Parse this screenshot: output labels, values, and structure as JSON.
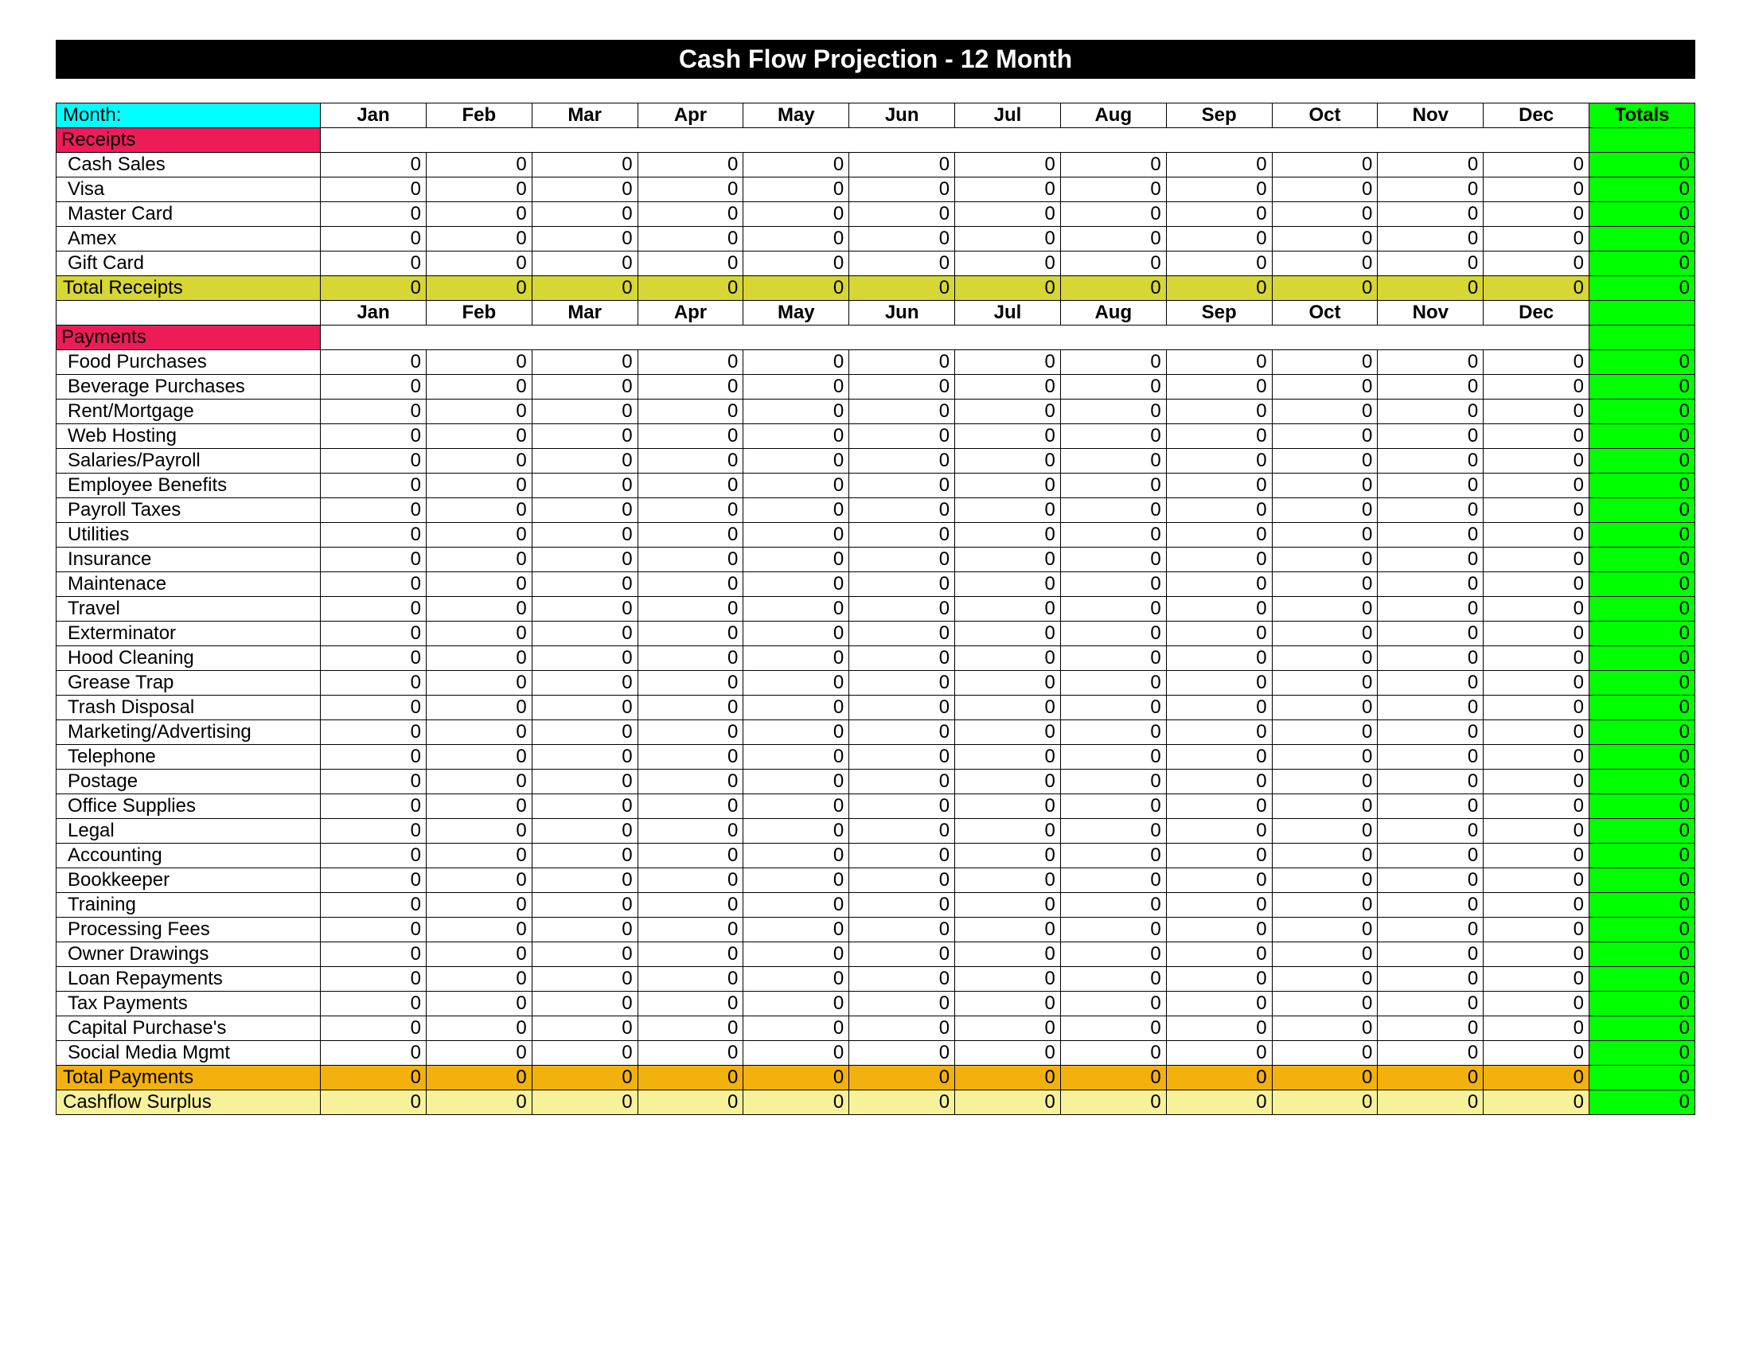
{
  "title": "Cash Flow Projection   -    12 Month",
  "month_label": "Month:",
  "months": [
    "Jan",
    "Feb",
    "Mar",
    "Apr",
    "May",
    "Jun",
    "Jul",
    "Aug",
    "Sep",
    "Oct",
    "Nov",
    "Dec"
  ],
  "totals_header": "Totals",
  "sections": {
    "receipts": {
      "label": "Receipts",
      "rows": [
        {
          "label": "Cash Sales",
          "v": [
            0,
            0,
            0,
            0,
            0,
            0,
            0,
            0,
            0,
            0,
            0,
            0
          ],
          "t": 0
        },
        {
          "label": "Visa",
          "v": [
            0,
            0,
            0,
            0,
            0,
            0,
            0,
            0,
            0,
            0,
            0,
            0
          ],
          "t": 0
        },
        {
          "label": "Master Card",
          "v": [
            0,
            0,
            0,
            0,
            0,
            0,
            0,
            0,
            0,
            0,
            0,
            0
          ],
          "t": 0
        },
        {
          "label": "Amex",
          "v": [
            0,
            0,
            0,
            0,
            0,
            0,
            0,
            0,
            0,
            0,
            0,
            0
          ],
          "t": 0
        },
        {
          "label": "Gift Card",
          "v": [
            0,
            0,
            0,
            0,
            0,
            0,
            0,
            0,
            0,
            0,
            0,
            0
          ],
          "t": 0
        }
      ],
      "total_label": "Total Receipts",
      "total_v": [
        0,
        0,
        0,
        0,
        0,
        0,
        0,
        0,
        0,
        0,
        0,
        0
      ],
      "total_t": 0
    },
    "payments": {
      "label": "Payments",
      "rows": [
        {
          "label": "Food Purchases",
          "v": [
            0,
            0,
            0,
            0,
            0,
            0,
            0,
            0,
            0,
            0,
            0,
            0
          ],
          "t": 0
        },
        {
          "label": "Beverage Purchases",
          "v": [
            0,
            0,
            0,
            0,
            0,
            0,
            0,
            0,
            0,
            0,
            0,
            0
          ],
          "t": 0
        },
        {
          "label": "Rent/Mortgage",
          "v": [
            0,
            0,
            0,
            0,
            0,
            0,
            0,
            0,
            0,
            0,
            0,
            0
          ],
          "t": 0
        },
        {
          "label": "Web Hosting",
          "v": [
            0,
            0,
            0,
            0,
            0,
            0,
            0,
            0,
            0,
            0,
            0,
            0
          ],
          "t": 0
        },
        {
          "label": "Salaries/Payroll",
          "v": [
            0,
            0,
            0,
            0,
            0,
            0,
            0,
            0,
            0,
            0,
            0,
            0
          ],
          "t": 0
        },
        {
          "label": "Employee Benefits",
          "v": [
            0,
            0,
            0,
            0,
            0,
            0,
            0,
            0,
            0,
            0,
            0,
            0
          ],
          "t": 0
        },
        {
          "label": "Payroll Taxes",
          "v": [
            0,
            0,
            0,
            0,
            0,
            0,
            0,
            0,
            0,
            0,
            0,
            0
          ],
          "t": 0
        },
        {
          "label": "Utilities",
          "v": [
            0,
            0,
            0,
            0,
            0,
            0,
            0,
            0,
            0,
            0,
            0,
            0
          ],
          "t": 0
        },
        {
          "label": "Insurance",
          "v": [
            0,
            0,
            0,
            0,
            0,
            0,
            0,
            0,
            0,
            0,
            0,
            0
          ],
          "t": 0
        },
        {
          "label": "Maintenace",
          "v": [
            0,
            0,
            0,
            0,
            0,
            0,
            0,
            0,
            0,
            0,
            0,
            0
          ],
          "t": 0
        },
        {
          "label": "Travel",
          "v": [
            0,
            0,
            0,
            0,
            0,
            0,
            0,
            0,
            0,
            0,
            0,
            0
          ],
          "t": 0
        },
        {
          "label": "Exterminator",
          "v": [
            0,
            0,
            0,
            0,
            0,
            0,
            0,
            0,
            0,
            0,
            0,
            0
          ],
          "t": 0
        },
        {
          "label": "Hood Cleaning",
          "v": [
            0,
            0,
            0,
            0,
            0,
            0,
            0,
            0,
            0,
            0,
            0,
            0
          ],
          "t": 0
        },
        {
          "label": "Grease Trap",
          "v": [
            0,
            0,
            0,
            0,
            0,
            0,
            0,
            0,
            0,
            0,
            0,
            0
          ],
          "t": 0
        },
        {
          "label": "Trash Disposal",
          "v": [
            0,
            0,
            0,
            0,
            0,
            0,
            0,
            0,
            0,
            0,
            0,
            0
          ],
          "t": 0
        },
        {
          "label": "Marketing/Advertising",
          "v": [
            0,
            0,
            0,
            0,
            0,
            0,
            0,
            0,
            0,
            0,
            0,
            0
          ],
          "t": 0
        },
        {
          "label": "Telephone",
          "v": [
            0,
            0,
            0,
            0,
            0,
            0,
            0,
            0,
            0,
            0,
            0,
            0
          ],
          "t": 0
        },
        {
          "label": "Postage",
          "v": [
            0,
            0,
            0,
            0,
            0,
            0,
            0,
            0,
            0,
            0,
            0,
            0
          ],
          "t": 0
        },
        {
          "label": "Office Supplies",
          "v": [
            0,
            0,
            0,
            0,
            0,
            0,
            0,
            0,
            0,
            0,
            0,
            0
          ],
          "t": 0
        },
        {
          "label": "Legal",
          "v": [
            0,
            0,
            0,
            0,
            0,
            0,
            0,
            0,
            0,
            0,
            0,
            0
          ],
          "t": 0
        },
        {
          "label": "Accounting",
          "v": [
            0,
            0,
            0,
            0,
            0,
            0,
            0,
            0,
            0,
            0,
            0,
            0
          ],
          "t": 0
        },
        {
          "label": "Bookkeeper",
          "v": [
            0,
            0,
            0,
            0,
            0,
            0,
            0,
            0,
            0,
            0,
            0,
            0
          ],
          "t": 0
        },
        {
          "label": "Training",
          "v": [
            0,
            0,
            0,
            0,
            0,
            0,
            0,
            0,
            0,
            0,
            0,
            0
          ],
          "t": 0
        },
        {
          "label": "Processing Fees",
          "v": [
            0,
            0,
            0,
            0,
            0,
            0,
            0,
            0,
            0,
            0,
            0,
            0
          ],
          "t": 0
        },
        {
          "label": "Owner Drawings",
          "v": [
            0,
            0,
            0,
            0,
            0,
            0,
            0,
            0,
            0,
            0,
            0,
            0
          ],
          "t": 0
        },
        {
          "label": "Loan Repayments",
          "v": [
            0,
            0,
            0,
            0,
            0,
            0,
            0,
            0,
            0,
            0,
            0,
            0
          ],
          "t": 0
        },
        {
          "label": "Tax Payments",
          "v": [
            0,
            0,
            0,
            0,
            0,
            0,
            0,
            0,
            0,
            0,
            0,
            0
          ],
          "t": 0
        },
        {
          "label": "Capital Purchase's",
          "v": [
            0,
            0,
            0,
            0,
            0,
            0,
            0,
            0,
            0,
            0,
            0,
            0
          ],
          "t": 0
        },
        {
          "label": "Social Media Mgmt",
          "v": [
            0,
            0,
            0,
            0,
            0,
            0,
            0,
            0,
            0,
            0,
            0,
            0
          ],
          "t": 0
        }
      ],
      "total_label": "Total Payments",
      "total_v": [
        0,
        0,
        0,
        0,
        0,
        0,
        0,
        0,
        0,
        0,
        0,
        0
      ],
      "total_t": 0
    },
    "surplus": {
      "label": "Cashflow Surplus",
      "v": [
        0,
        0,
        0,
        0,
        0,
        0,
        0,
        0,
        0,
        0,
        0,
        0
      ],
      "t": 0
    }
  }
}
